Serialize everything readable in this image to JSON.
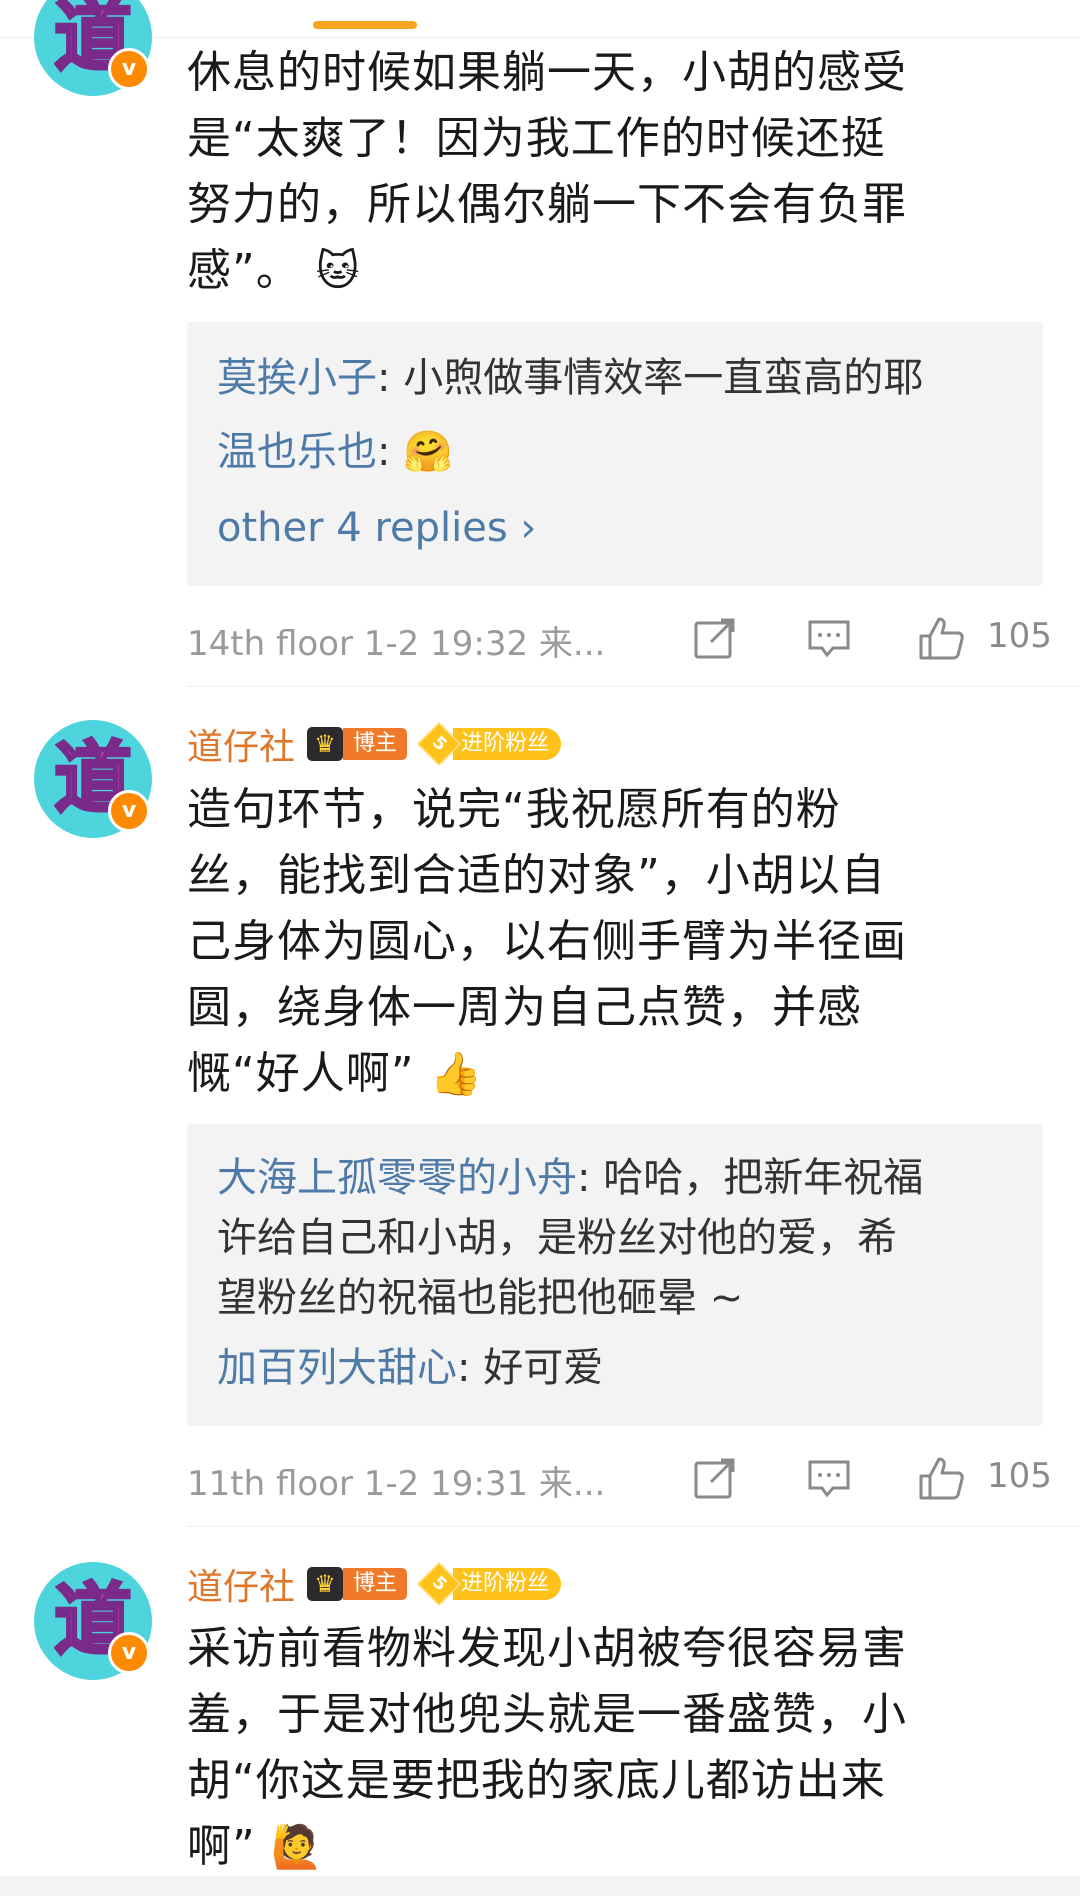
{
  "comments": [
    {
      "avatar_char": "道",
      "verified": "v",
      "text_lines": [
        "休息的时候如果躺一天，小胡的感受",
        "是“太爽了！因为我工作的时候还挺",
        "努力的，所以偶尔躺一下不会有负罪",
        "感”。"
      ],
      "text_emoji": "🐱",
      "replies": [
        {
          "name": "莫挨小子",
          "sep": ": ",
          "text": "小煦做事情效率一直蛮高的耶"
        },
        {
          "name": "温也乐也",
          "sep": ": ",
          "text": "🤗"
        }
      ],
      "more_replies": "other 4 replies",
      "more_arrow": "›",
      "meta": "14th floor 1-2 19:32 来...",
      "likes": "105"
    },
    {
      "avatar_char": "道",
      "verified": "v",
      "username": "道仔社",
      "crown_label": "博主",
      "fan_level": "5",
      "fan_label": "进阶粉丝",
      "text_lines": [
        "造句环节，说完“我祝愿所有的粉",
        "丝，能找到合适的对象”，小胡以自",
        "己身体为圆心，以右侧手臂为半径画",
        "圆，绕身体一周为自己点赞，并感",
        "慨“好人啊”"
      ],
      "text_emoji": "👍",
      "replies": [
        {
          "name": "大海上孤零零的小舟",
          "sep": ": ",
          "text": "哈哈，把新年祝福"
        },
        {
          "name": "",
          "sep": "",
          "text": "许给自己和小胡，是粉丝对他的爱，希"
        },
        {
          "name": "",
          "sep": "",
          "text": "望粉丝的祝福也能把他砸晕 ~"
        },
        {
          "name": "加百列大甜心",
          "sep": ": ",
          "text": "好可爱"
        }
      ],
      "meta": "11th floor 1-2 19:31 来...",
      "likes": "105"
    },
    {
      "avatar_char": "道",
      "verified": "v",
      "username": "道仔社",
      "crown_label": "博主",
      "fan_level": "5",
      "fan_label": "进阶粉丝",
      "text_lines": [
        "采访前看物料发现小胡被夸很容易害",
        "羞，于是对他兜头就是一番盛赞，小",
        "胡“你这是要把我的家底儿都访出来",
        "啊”"
      ],
      "text_emoji": "🙋"
    }
  ]
}
